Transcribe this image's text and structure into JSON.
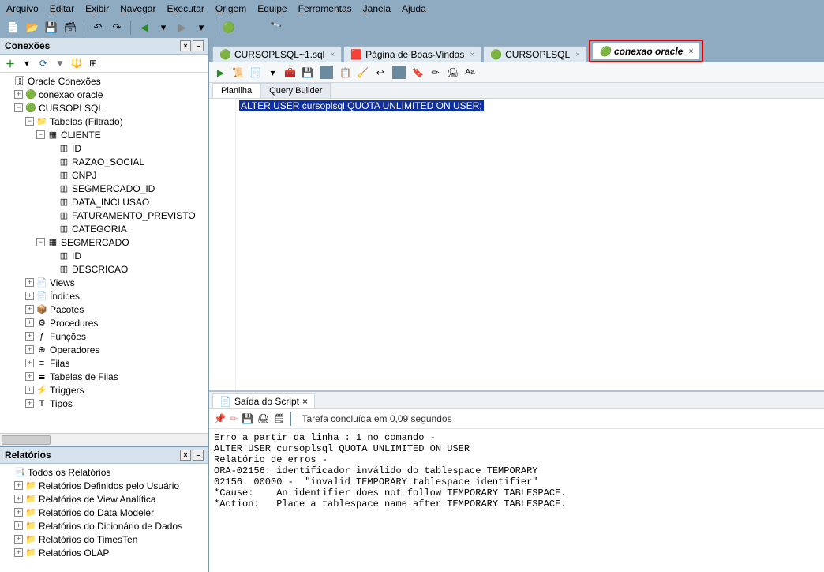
{
  "menu": [
    "Arquivo",
    "Editar",
    "Exibir",
    "Navegar",
    "Executar",
    "Origem",
    "Equipe",
    "Ferramentas",
    "Janela",
    "Ajuda"
  ],
  "menu_underline_index": [
    0,
    0,
    1,
    0,
    1,
    0,
    4,
    0,
    0,
    1
  ],
  "connections_panel": {
    "title": "Conexões"
  },
  "reports_panel": {
    "title": "Relatórios"
  },
  "tree": [
    {
      "depth": 0,
      "tog": "",
      "icon": "🗄",
      "label": "Oracle Conexões",
      "int": false
    },
    {
      "depth": 1,
      "tog": "+",
      "icon": "🟢",
      "label": "conexao oracle",
      "int": true
    },
    {
      "depth": 1,
      "tog": "−",
      "icon": "🟢",
      "label": "CURSOPLSQL",
      "int": true
    },
    {
      "depth": 2,
      "tog": "−",
      "icon": "📁",
      "label": "Tabelas (Filtrado)",
      "int": true
    },
    {
      "depth": 3,
      "tog": "−",
      "icon": "▦",
      "label": "CLIENTE",
      "int": true
    },
    {
      "depth": 4,
      "tog": "",
      "icon": "▥",
      "label": "ID",
      "int": true
    },
    {
      "depth": 4,
      "tog": "",
      "icon": "▥",
      "label": "RAZAO_SOCIAL",
      "int": true
    },
    {
      "depth": 4,
      "tog": "",
      "icon": "▥",
      "label": "CNPJ",
      "int": true
    },
    {
      "depth": 4,
      "tog": "",
      "icon": "▥",
      "label": "SEGMERCADO_ID",
      "int": true
    },
    {
      "depth": 4,
      "tog": "",
      "icon": "▥",
      "label": "DATA_INCLUSAO",
      "int": true
    },
    {
      "depth": 4,
      "tog": "",
      "icon": "▥",
      "label": "FATURAMENTO_PREVISTO",
      "int": true
    },
    {
      "depth": 4,
      "tog": "",
      "icon": "▥",
      "label": "CATEGORIA",
      "int": true
    },
    {
      "depth": 3,
      "tog": "−",
      "icon": "▦",
      "label": "SEGMERCADO",
      "int": true
    },
    {
      "depth": 4,
      "tog": "",
      "icon": "▥",
      "label": "ID",
      "int": true
    },
    {
      "depth": 4,
      "tog": "",
      "icon": "▥",
      "label": "DESCRICAO",
      "int": true
    },
    {
      "depth": 2,
      "tog": "+",
      "icon": "📄",
      "label": "Views",
      "int": true
    },
    {
      "depth": 2,
      "tog": "+",
      "icon": "📄",
      "label": "Índices",
      "int": true
    },
    {
      "depth": 2,
      "tog": "+",
      "icon": "📦",
      "label": "Pacotes",
      "int": true
    },
    {
      "depth": 2,
      "tog": "+",
      "icon": "⚙",
      "label": "Procedures",
      "int": true
    },
    {
      "depth": 2,
      "tog": "+",
      "icon": "ƒ",
      "label": "Funções",
      "int": true
    },
    {
      "depth": 2,
      "tog": "+",
      "icon": "⊕",
      "label": "Operadores",
      "int": true
    },
    {
      "depth": 2,
      "tog": "+",
      "icon": "≡",
      "label": "Filas",
      "int": true
    },
    {
      "depth": 2,
      "tog": "+",
      "icon": "≣",
      "label": "Tabelas de Filas",
      "int": true
    },
    {
      "depth": 2,
      "tog": "+",
      "icon": "⚡",
      "label": "Triggers",
      "int": true
    },
    {
      "depth": 2,
      "tog": "+",
      "icon": "T",
      "label": "Tipos",
      "int": true
    }
  ],
  "reports_tree": [
    {
      "depth": 0,
      "tog": "",
      "icon": "📑",
      "label": "Todos os Relatórios",
      "int": true
    },
    {
      "depth": 1,
      "tog": "+",
      "icon": "📁",
      "label": "Relatórios Definidos pelo Usuário",
      "int": true
    },
    {
      "depth": 1,
      "tog": "+",
      "icon": "📁",
      "label": "Relatórios de View Analítica",
      "int": true
    },
    {
      "depth": 1,
      "tog": "+",
      "icon": "📁",
      "label": "Relatórios do Data Modeler",
      "int": true
    },
    {
      "depth": 1,
      "tog": "+",
      "icon": "📁",
      "label": "Relatórios do Dicionário de Dados",
      "int": true
    },
    {
      "depth": 1,
      "tog": "+",
      "icon": "📁",
      "label": "Relatórios do TimesTen",
      "int": true
    },
    {
      "depth": 1,
      "tog": "+",
      "icon": "📁",
      "label": "Relatórios OLAP",
      "int": true
    }
  ],
  "tabs": [
    {
      "icon": "🟢",
      "label": "CURSOPLSQL~1.sql",
      "active": false
    },
    {
      "icon": "🟥",
      "label": "Página de Boas-Vindas",
      "active": false
    },
    {
      "icon": "🟢",
      "label": "CURSOPLSQL",
      "active": false
    },
    {
      "icon": "🟢",
      "label": "conexao oracle",
      "active": true,
      "highlight": true
    }
  ],
  "ws_tabs": {
    "sheet": "Planilha",
    "qb": "Query Builder"
  },
  "sql": "ALTER USER cursoplsql QUOTA UNLIMITED ON USER;",
  "output_tab": "Saída do Script",
  "output_status": "Tarefa concluída em 0,09 segundos",
  "output_text": "Erro a partir da linha : 1 no comando -\nALTER USER cursoplsql QUOTA UNLIMITED ON USER\nRelatório de erros -\nORA-02156: identificador inválido do tablespace TEMPORARY\n02156. 00000 -  \"invalid TEMPORARY tablespace identifier\"\n*Cause:    An identifier does not follow TEMPORARY TABLESPACE.\n*Action:   Place a tablespace name after TEMPORARY TABLESPACE."
}
